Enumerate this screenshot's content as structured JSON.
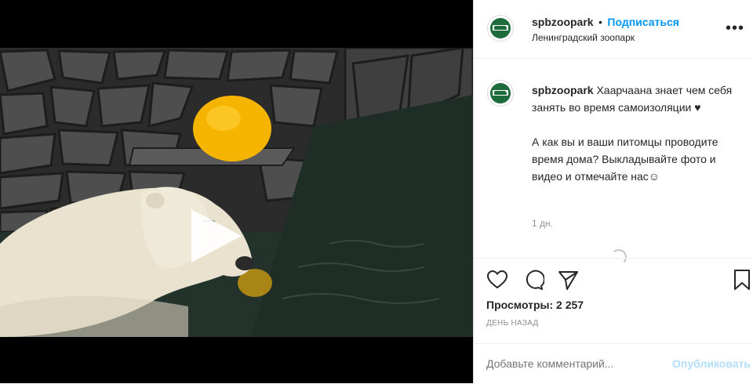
{
  "header": {
    "username": "spbzoopark",
    "separator": "•",
    "follow_label": "Подписаться",
    "location": "Ленинградский зоопарк",
    "more_icon": "more-dots-icon"
  },
  "caption": {
    "username": "spbzoopark",
    "line1": "Хаарчаана знает чем себя занять во время самоизоляции ♥",
    "line2": "А как вы и ваши питомцы проводите время дома? Выкладывайте фото и видео и отмечайте нас☺",
    "time": "1 дн."
  },
  "actions": {
    "like_icon": "heart-icon",
    "comment_icon": "comment-icon",
    "share_icon": "share-icon",
    "save_icon": "bookmark-icon"
  },
  "stats": {
    "views": "Просмотры: 2 257",
    "ago": "ДЕНЬ НАЗАД"
  },
  "comment": {
    "placeholder": "Добавьте комментарий...",
    "publish_label": "Опубликовать"
  },
  "media": {
    "play_icon": "play-icon"
  },
  "colors": {
    "accent": "#0095f6",
    "publish_disabled": "#b2dffc",
    "avatar_green": "#1e6b3b"
  }
}
